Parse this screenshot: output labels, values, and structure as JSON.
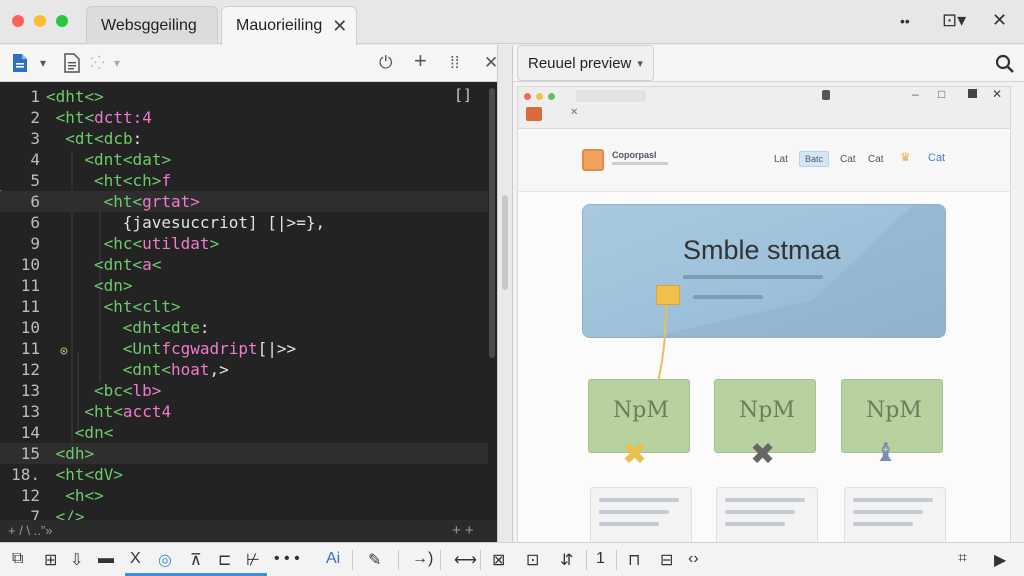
{
  "tabs": [
    {
      "label": "Websggeiling",
      "active": false
    },
    {
      "label": "Mauorieiling",
      "active": true,
      "close": "✕"
    }
  ],
  "window_controls": {
    "more": "••",
    "layout": "⊡▾",
    "close": "✕"
  },
  "editor_toolbar": {
    "file_icon": "file-icon",
    "dropdown": "▾",
    "doc_icon": "document-icon",
    "actions": [
      "⏻",
      "+",
      "⁞⁞",
      "✕"
    ]
  },
  "preview": {
    "select_label": "Reuuel preview",
    "search_icon": "search-icon",
    "mini_logo_text": "Coporpasl",
    "nav_links": [
      "Lat",
      "Batc",
      "Cat",
      "Cat",
      "Cat"
    ],
    "hero_title": "Smble stmaa",
    "card_label": "NpM",
    "colors": {
      "hero": "#a8c9e0",
      "card": "#b7d29e",
      "connector": "#e8c05a"
    }
  },
  "code_lines": [
    {
      "num": "1",
      "indent": 0,
      "parts": [
        [
          "tag",
          "<dht<>"
        ]
      ]
    },
    {
      "num": "2",
      "indent": 1,
      "parts": [
        [
          "tag",
          "<ht<"
        ],
        [
          "attr",
          "dctt:4"
        ]
      ]
    },
    {
      "num": "3",
      "indent": 2,
      "parts": [
        [
          "tag",
          "<dt<dcb"
        ],
        [
          "str",
          ":"
        ]
      ]
    },
    {
      "num": "4",
      "indent": 4,
      "parts": [
        [
          "tag",
          "<dnt<dat>"
        ]
      ]
    },
    {
      "num": "5",
      "indent": 5,
      "parts": [
        [
          "tag",
          "<ht<ch>"
        ],
        [
          "attr",
          "f"
        ]
      ]
    },
    {
      "num": "6",
      "indent": 6,
      "parts": [
        [
          "tag",
          "<ht<"
        ],
        [
          "attr",
          "grtat>"
        ]
      ]
    },
    {
      "num": "6",
      "indent": 8,
      "parts": [
        [
          "str",
          "{javesuccriot] [|>="
        ],
        [
          "str",
          "},"
        ]
      ]
    },
    {
      "num": "9",
      "indent": 6,
      "parts": [
        [
          "tag",
          "<hc<"
        ],
        [
          "attr",
          "utildat"
        ],
        [
          "tag",
          ">"
        ]
      ]
    },
    {
      "num": "10",
      "indent": 5,
      "parts": [
        [
          "tag",
          "<dnt<"
        ],
        [
          "attr",
          "a"
        ],
        [
          "tag",
          "<"
        ]
      ]
    },
    {
      "num": "11",
      "indent": 5,
      "parts": [
        [
          "tag",
          "<dn>"
        ]
      ]
    },
    {
      "num": "11",
      "indent": 6,
      "parts": [
        [
          "tag",
          "<ht<clt>"
        ]
      ]
    },
    {
      "num": "10",
      "indent": 8,
      "parts": [
        [
          "tag",
          "<dht<dte"
        ],
        [
          "str",
          ":"
        ]
      ]
    },
    {
      "num": "11",
      "indent": 8,
      "parts": [
        [
          "tag",
          "<Unt"
        ],
        [
          "attr",
          "fcgwadript"
        ],
        [
          "str",
          "[|>>"
        ]
      ]
    },
    {
      "num": "12",
      "indent": 8,
      "parts": [
        [
          "tag",
          "<dnt<"
        ],
        [
          "attr",
          "hoat"
        ],
        [
          "str",
          ",>"
        ]
      ]
    },
    {
      "num": "13",
      "indent": 5,
      "parts": [
        [
          "tag",
          "<bc<"
        ],
        [
          "attr",
          "lb>"
        ]
      ]
    },
    {
      "num": "13",
      "indent": 4,
      "parts": [
        [
          "tag",
          "<ht<"
        ],
        [
          "attr",
          "acct4"
        ]
      ]
    },
    {
      "num": "14",
      "indent": 3,
      "parts": [
        [
          "tag",
          "<dn<"
        ]
      ]
    },
    {
      "num": "15",
      "indent": 1,
      "parts": [
        [
          "tag",
          "<dh>"
        ]
      ]
    },
    {
      "num": "18.",
      "indent": 1,
      "parts": [
        [
          "tag",
          "<ht<dV>"
        ]
      ]
    },
    {
      "num": "12",
      "indent": 2,
      "parts": [
        [
          "tag",
          "<h<>"
        ]
      ]
    },
    {
      "num": "7",
      "indent": 1,
      "parts": [
        [
          "tag",
          "</>"
        ]
      ]
    }
  ],
  "editor_footer": {
    "left": "+ / \\ ..”»",
    "right": "+ +"
  },
  "bottom_toolbar": {
    "items": [
      "⧉",
      "⊞",
      "⇩",
      "▬",
      "X",
      "◎",
      "⊼",
      "⊏",
      "⊬",
      "• • •",
      "Ai",
      "✎",
      "→)",
      "⟷",
      "⊠",
      "⊡",
      "⇵",
      "1",
      "⊓",
      "⊟",
      "‹›",
      "⌗",
      "▶"
    ]
  }
}
